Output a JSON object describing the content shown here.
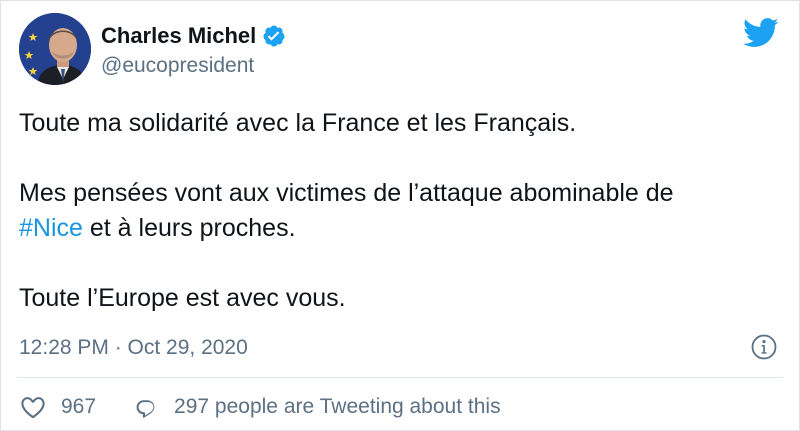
{
  "author": {
    "display_name": "Charles Michel",
    "handle": "@eucopresident",
    "verified": true
  },
  "tweet": {
    "line1": "Toute ma solidarité avec la France et les Français.",
    "line2": "Mes pensées vont aux victimes de l’attaque abominable de",
    "hashtag": "#Nice",
    "line3_rest": " et à leurs proches.",
    "line4": "Toute l’Europe est avec vous."
  },
  "meta": {
    "timestamp": "12:28 PM · Oct 29, 2020"
  },
  "footer": {
    "likes_count": "967",
    "conversation_text": "297 people are Tweeting about this"
  },
  "colors": {
    "twitter_blue": "#1da1f2",
    "hashtag_blue": "#1b95e0",
    "secondary_text": "#5b7083",
    "primary_text": "#0f1419"
  },
  "icons": {
    "logo": "twitter-bird-icon",
    "verified": "verified-badge-icon",
    "info": "info-icon",
    "like": "heart-icon",
    "reply": "speech-bubble-icon"
  }
}
